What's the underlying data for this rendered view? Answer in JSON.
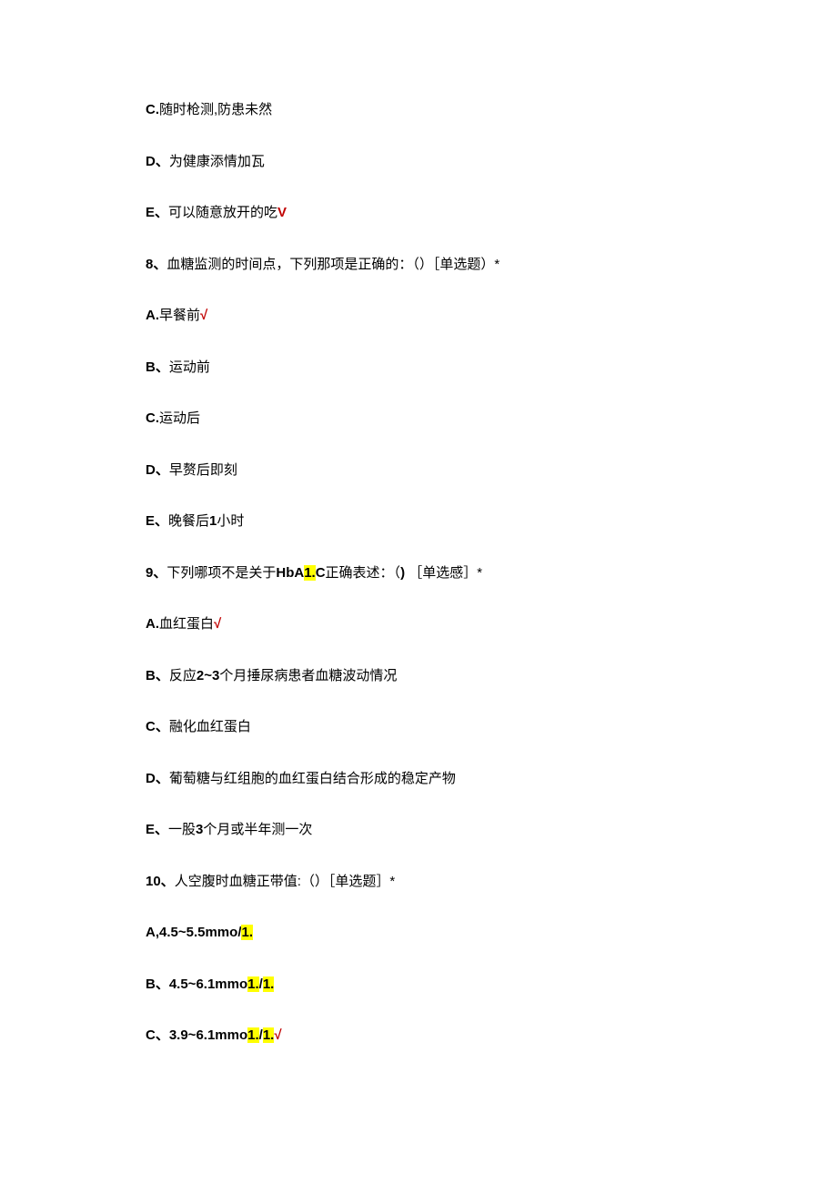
{
  "lines": [
    {
      "prefix": "C.",
      "text": "随时枪测,防患未然",
      "boldPrefix": true
    },
    {
      "prefix": "D、",
      "text": "为健康添情加瓦",
      "boldPrefix": true
    },
    {
      "prefix": "E、",
      "text": "可以随意放开的吃",
      "boldPrefix": true,
      "check": "V"
    },
    {
      "prefix": "8、",
      "text": "血糖监测的时间点，下列那项是正确的：（）［单选题）*",
      "boldPrefix": true
    },
    {
      "prefix": "A.",
      "text": "早餐前",
      "boldPrefix": true,
      "check": "√"
    },
    {
      "prefix": "B、",
      "text": "运动前",
      "boldPrefix": true
    },
    {
      "prefix": "C.",
      "text": "运动后",
      "boldPrefix": true
    },
    {
      "prefix": "D、",
      "text": "早赘后即刻",
      "boldPrefix": true
    },
    {
      "prefix": "E、",
      "text": "晚餐后",
      "boldPrefix": true,
      "bold2": "1",
      "suffix": "小时"
    },
    {
      "prefix": "9、",
      "text": "下列哪项不是关于",
      "boldPrefix": true,
      "bold2": "HbA",
      "hl": "1.",
      "bold3": "C",
      "suffix2": "正确表述：（",
      "bold4": ")",
      "suffix3": "［单选感］*"
    },
    {
      "prefix": "A.",
      "text": "血红蛋白",
      "boldPrefix": true,
      "check": "√"
    },
    {
      "prefix": "B、",
      "text": "反应",
      "boldPrefix": true,
      "bold2": "2~3",
      "suffix": "个月捶尿病患者血糖波动情况"
    },
    {
      "prefix": "C、",
      "text": "融化血红蛋白",
      "boldPrefix": true
    },
    {
      "prefix": "D、",
      "text": "葡萄糖与红组胞的血红蛋白结合形成的稳定产物",
      "boldPrefix": true
    },
    {
      "prefix": "E、",
      "text": "一股",
      "boldPrefix": true,
      "bold2": "3",
      "suffix": "个月或半年测一次"
    },
    {
      "prefix": "10、",
      "text": "人空腹时血糖正带值:（）［单选题］*",
      "boldPrefix": true
    },
    {
      "prefix": "A,4.5~5.5mmo",
      "allBold": true,
      "slash": "/",
      "hl": "1."
    },
    {
      "prefix": "B、4.5~6.1mmo",
      "allBold": true,
      "hl": "1.",
      "slash": "/",
      "hl2": "1."
    },
    {
      "prefix": "C、3.9~6.1mmo",
      "allBold": true,
      "hl": "1.",
      "slash": "/",
      "hl2": "1.",
      "check": "√"
    }
  ]
}
